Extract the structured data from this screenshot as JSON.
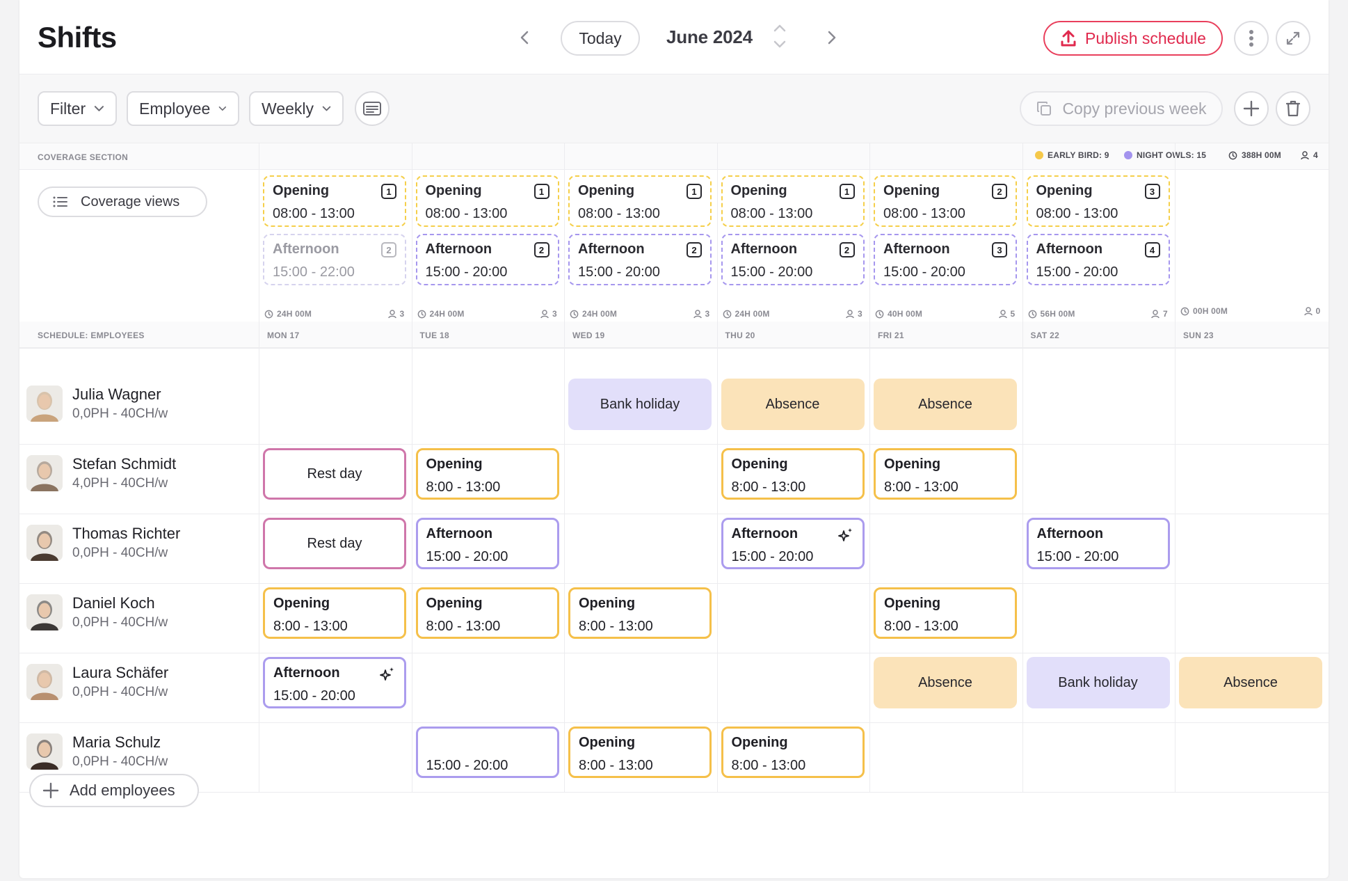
{
  "header": {
    "title": "Shifts",
    "today_label": "Today",
    "month_label": "June 2024",
    "publish_label": "Publish schedule"
  },
  "toolbar": {
    "filter_label": "Filter",
    "employee_label": "Employee",
    "period_label": "Weekly",
    "copy_label": "Copy previous week"
  },
  "coverage": {
    "section_label": "COVERAGE SECTION",
    "views_label": "Coverage views",
    "legend": {
      "early_bird": "EARLY BIRD: 9",
      "night_owls": "NIGHT OWLS: 15",
      "total_hours": "388H 00M",
      "total_people": "4"
    },
    "colors": {
      "early_bird": "#f5c84a",
      "night_owls": "#a393ee"
    },
    "days": [
      {
        "opening": {
          "name": "Opening",
          "time": "08:00 - 13:00",
          "count": "1"
        },
        "afternoon": {
          "name": "Afternoon",
          "time": "15:00 - 22:00",
          "count": "2"
        },
        "hours": "24H 00M",
        "people": "3"
      },
      {
        "opening": {
          "name": "Opening",
          "time": "08:00 - 13:00",
          "count": "1"
        },
        "afternoon": {
          "name": "Afternoon",
          "time": "15:00 - 20:00",
          "count": "2"
        },
        "hours": "24H 00M",
        "people": "3"
      },
      {
        "opening": {
          "name": "Opening",
          "time": "08:00 - 13:00",
          "count": "1"
        },
        "afternoon": {
          "name": "Afternoon",
          "time": "15:00 - 20:00",
          "count": "2"
        },
        "hours": "24H 00M",
        "people": "3"
      },
      {
        "opening": {
          "name": "Opening",
          "time": "08:00 - 13:00",
          "count": "1"
        },
        "afternoon": {
          "name": "Afternoon",
          "time": "15:00 - 20:00",
          "count": "2"
        },
        "hours": "24H 00M",
        "people": "3"
      },
      {
        "opening": {
          "name": "Opening",
          "time": "08:00 - 13:00",
          "count": "2"
        },
        "afternoon": {
          "name": "Afternoon",
          "time": "15:00 - 20:00",
          "count": "3"
        },
        "hours": "40H 00M",
        "people": "5"
      },
      {
        "opening": {
          "name": "Opening",
          "time": "08:00 - 13:00",
          "count": "3"
        },
        "afternoon": {
          "name": "Afternoon",
          "time": "15:00 - 20:00",
          "count": "4"
        },
        "hours": "56H 00M",
        "people": "7"
      },
      {
        "hours": "00H 00M",
        "people": "0"
      }
    ]
  },
  "schedule": {
    "section_label": "SCHEDULE: EMPLOYEES",
    "days": [
      "MON 17",
      "TUE 18",
      "WED 19",
      "THU 20",
      "FRI 21",
      "SAT 22",
      "SUN 23"
    ],
    "employees": [
      {
        "name": "Julia Wagner",
        "meta": "0,0PH - 40CH/w",
        "avatar_color": "#c9a37c"
      },
      {
        "name": "Stefan Schmidt",
        "meta": "4,0PH - 40CH/w",
        "avatar_color": "#8a7360"
      },
      {
        "name": "Thomas Richter",
        "meta": "0,0PH - 40CH/w",
        "avatar_color": "#4a3a30"
      },
      {
        "name": "Daniel Koch",
        "meta": "0,0PH - 40CH/w",
        "avatar_color": "#3c3836"
      },
      {
        "name": "Laura Schäfer",
        "meta": "0,0PH - 40CH/w",
        "avatar_color": "#b89070"
      },
      {
        "name": "Maria Schulz",
        "meta": "0,0PH - 40CH/w",
        "avatar_color": "#3a2c26"
      }
    ],
    "labels": {
      "opening": "Opening",
      "afternoon": "Afternoon",
      "rest": "Rest day",
      "bank": "Bank holiday",
      "absence": "Absence",
      "open_time": "8:00 - 13:00",
      "aft_time": "15:00 - 20:00"
    }
  },
  "add_employees_label": "Add employees"
}
